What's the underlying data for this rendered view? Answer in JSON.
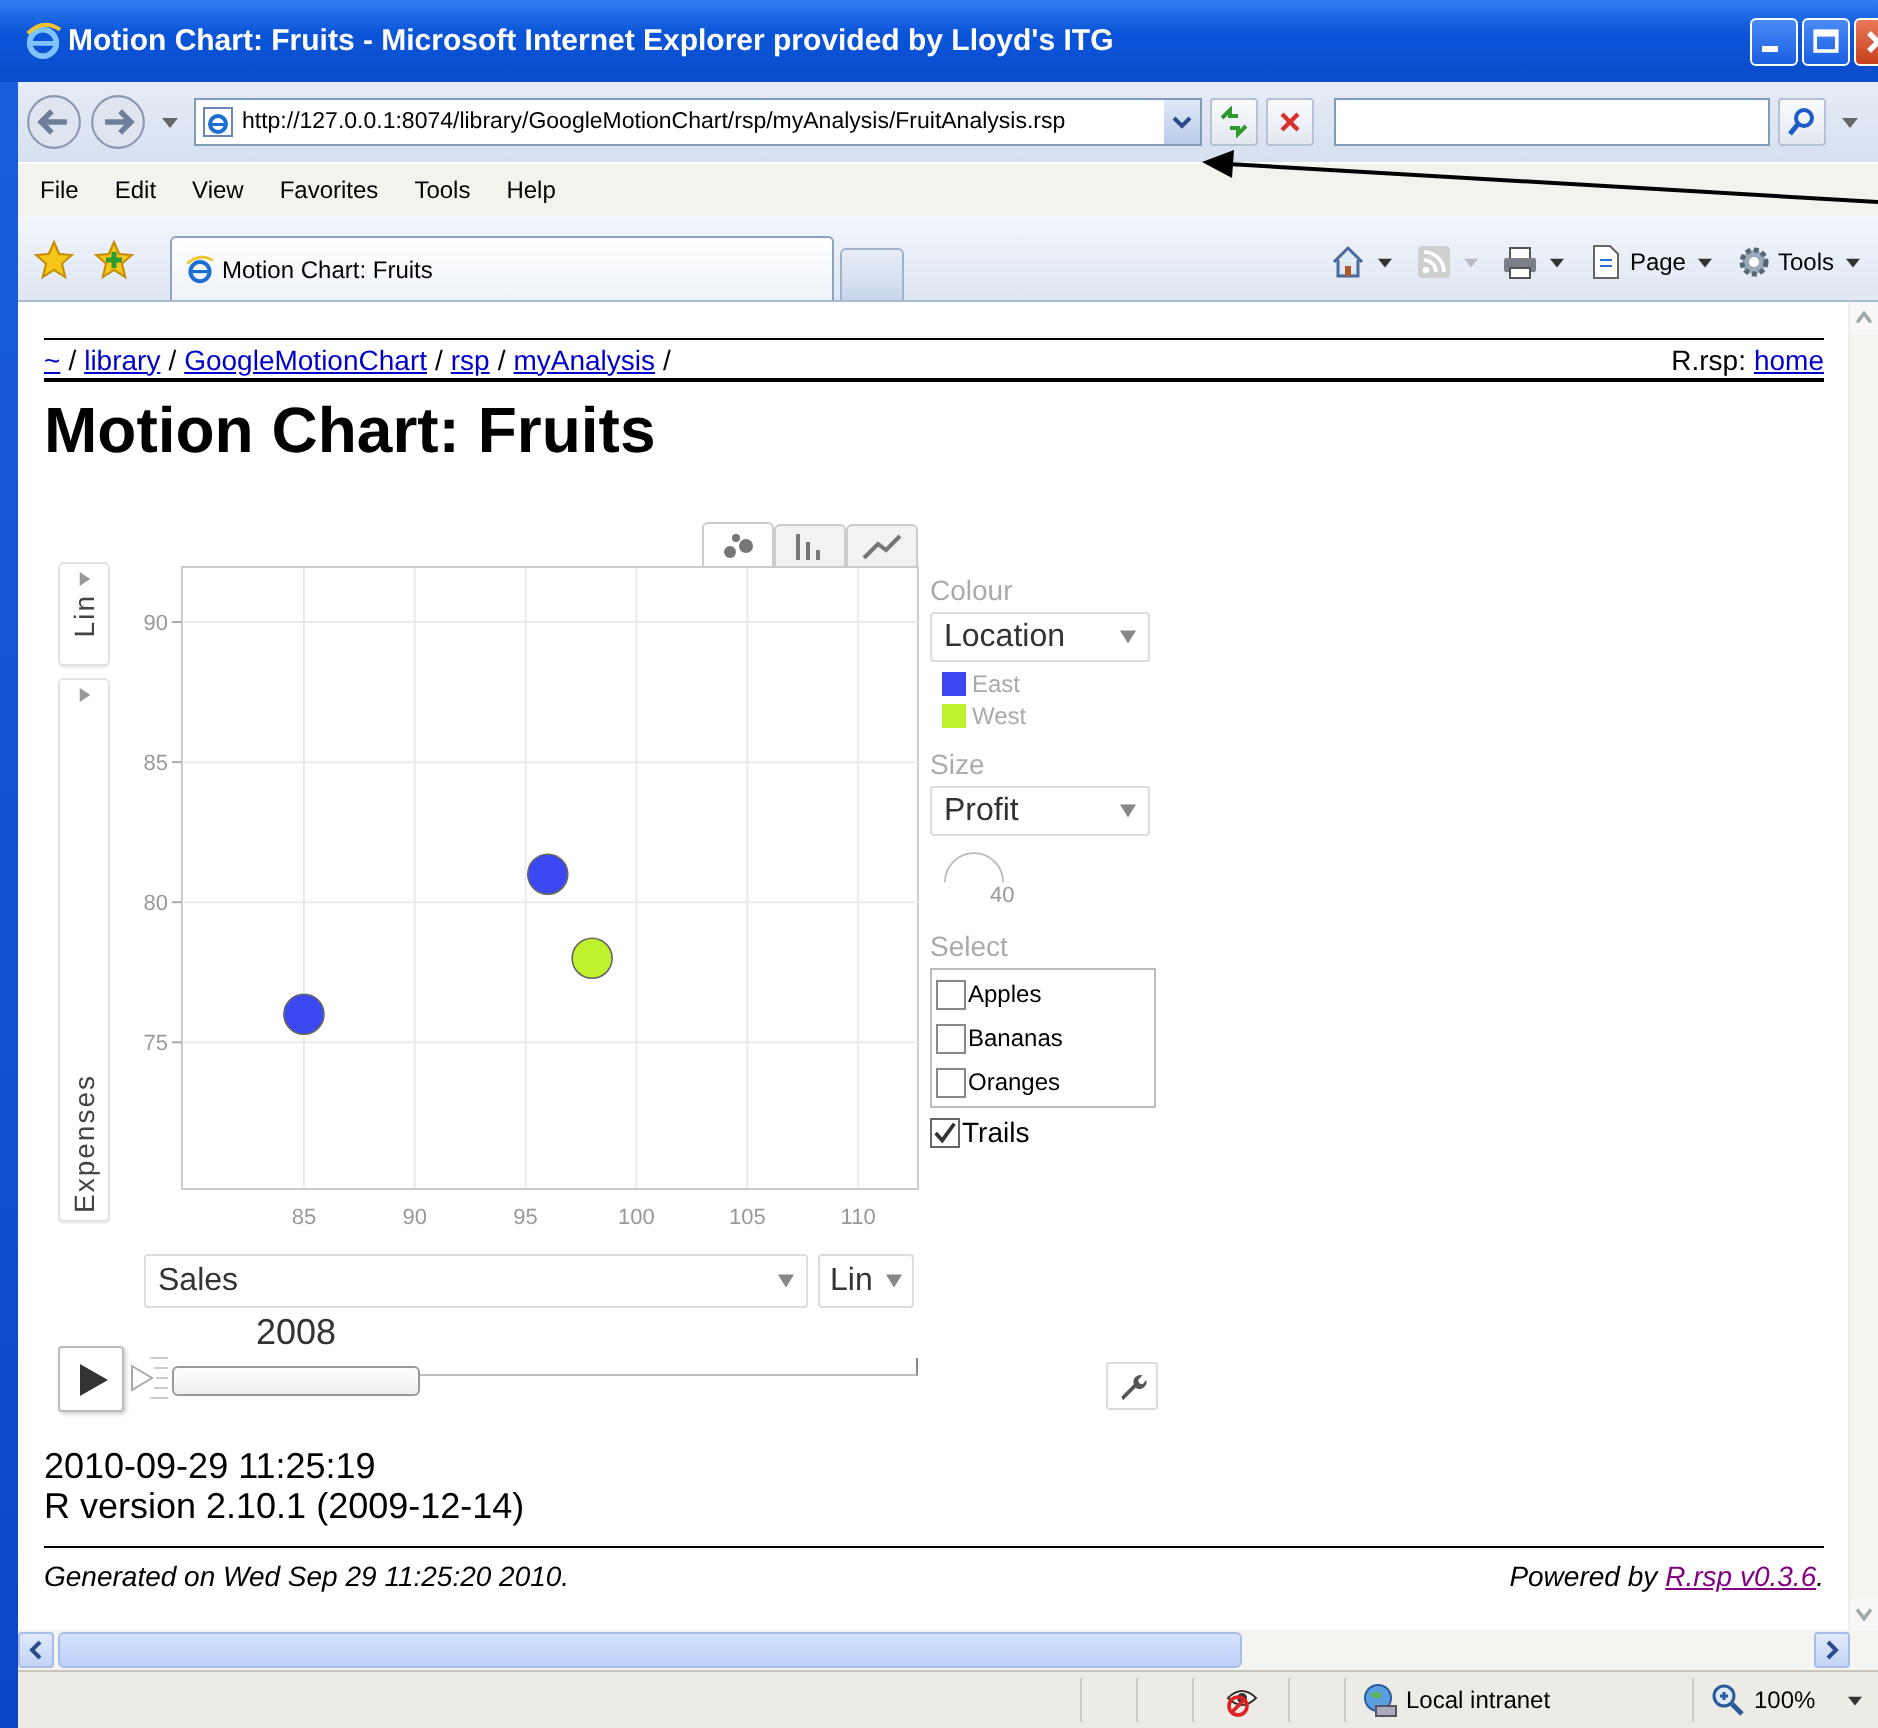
{
  "window": {
    "title": "Motion Chart: Fruits - Microsoft Internet Explorer provided by Lloyd's ITG"
  },
  "address_bar": {
    "url": "http://127.0.0.1:8074/library/GoogleMotionChart/rsp/myAnalysis/FruitAnalysis.rsp"
  },
  "menu": [
    "File",
    "Edit",
    "View",
    "Favorites",
    "Tools",
    "Help"
  ],
  "tabs": [
    {
      "label": "Motion Chart: Fruits",
      "selected": true
    }
  ],
  "command_bar": [
    "Page",
    "Tools"
  ],
  "breadcrumb": [
    {
      "label": "~",
      "separator": "/"
    },
    {
      "label": "library",
      "separator": "/"
    },
    {
      "label": "GoogleMotionChart",
      "separator": "/"
    },
    {
      "label": "rsp",
      "separator": "/"
    },
    {
      "label": "myAnalysis",
      "separator": "/"
    }
  ],
  "breadcrumb_right": {
    "label": "R.rsp:",
    "link": "home"
  },
  "heading": "Motion Chart: Fruits",
  "motion_chart": {
    "chart_tabs": [
      {
        "kind": "bubble",
        "selected": true
      },
      {
        "kind": "bar",
        "selected": false
      },
      {
        "kind": "line",
        "selected": false
      }
    ],
    "y_axis": {
      "scale": "Lin"
    },
    "x_axis": {
      "scale": "Lin"
    },
    "chart_data": {
      "type": "scatter",
      "xlabel": "Sales",
      "ylabel": "Expenses",
      "grid": true,
      "x": [
        85,
        96,
        98
      ],
      "series": [
        {
          "name": "East",
          "color": "#3b48f2",
          "values": [
            76,
            81,
            null
          ]
        },
        {
          "name": "West",
          "color": "#bdf22c",
          "values": [
            null,
            null,
            78
          ]
        }
      ],
      "xlim": [
        79.5,
        112.7
      ],
      "ylim": [
        69.8,
        92
      ],
      "xticks": [
        85,
        90,
        95,
        100,
        105,
        110
      ],
      "yticks": [
        75,
        80,
        85,
        90
      ]
    },
    "colour": {
      "label": "Colour",
      "value": "Location"
    },
    "size": {
      "label": "Size",
      "value": "Profit",
      "reading": "40"
    },
    "select": {
      "label": "Select",
      "items": [
        {
          "label": "Apples",
          "checked": false
        },
        {
          "label": "Bananas",
          "checked": false
        },
        {
          "label": "Oranges",
          "checked": false
        }
      ]
    },
    "trails": {
      "label": "Trails",
      "checked": true
    },
    "time": {
      "year": "2008",
      "level": 0
    }
  },
  "run_info": [
    "2010-09-29 11:25:19",
    "R version 2.10.1 (2009-12-14)"
  ],
  "footer": {
    "generated": "Generated on Wed Sep 29 11:25:20 2010.",
    "powered_prefix": "Powered by",
    "powered_link": "R.rsp v0.3.6",
    "powered_suffix": "."
  },
  "status_bar": {
    "zone": "Local intranet",
    "zoom": "100%"
  }
}
